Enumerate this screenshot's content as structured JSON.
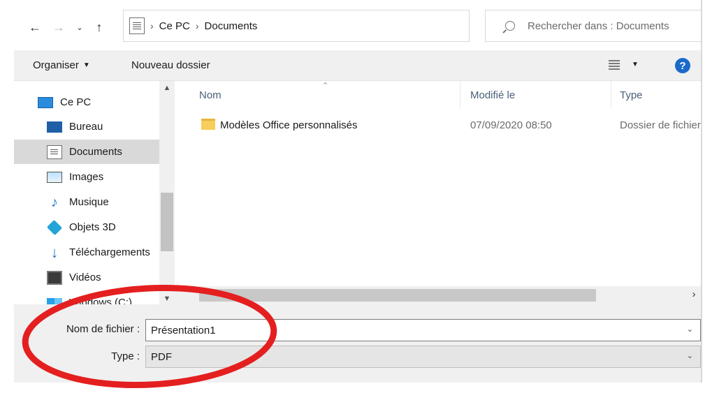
{
  "address_bar": {
    "crumbs": [
      "Ce PC",
      "Documents"
    ],
    "search_placeholder": "Rechercher dans : Documents"
  },
  "toolbar": {
    "organize_label": "Organiser",
    "new_folder_label": "Nouveau dossier"
  },
  "sidebar": {
    "items": [
      {
        "label": "Ce PC",
        "icon": "computer-icon"
      },
      {
        "label": "Bureau",
        "icon": "desktop-icon"
      },
      {
        "label": "Documents",
        "icon": "documents-icon",
        "selected": true
      },
      {
        "label": "Images",
        "icon": "pictures-icon"
      },
      {
        "label": "Musique",
        "icon": "music-icon"
      },
      {
        "label": "Objets 3D",
        "icon": "3d-objects-icon"
      },
      {
        "label": "Téléchargements",
        "icon": "downloads-icon"
      },
      {
        "label": "Vidéos",
        "icon": "videos-icon"
      },
      {
        "label": "Windows (C:)",
        "icon": "drive-icon"
      }
    ]
  },
  "filelist": {
    "columns": {
      "name": "Nom",
      "modified": "Modifié le",
      "type": "Type"
    },
    "rows": [
      {
        "name": "Modèles Office personnalisés",
        "modified": "07/09/2020 08:50",
        "type": "Dossier de fichiers"
      }
    ]
  },
  "form": {
    "filename_label": "Nom de fichier :",
    "filename_value": "Présentation1",
    "type_label": "Type :",
    "type_value": "PDF"
  },
  "colors": {
    "annotation": "#e41f1f",
    "help_icon": "#1b6ac9",
    "selection": "#d9d9d9"
  }
}
